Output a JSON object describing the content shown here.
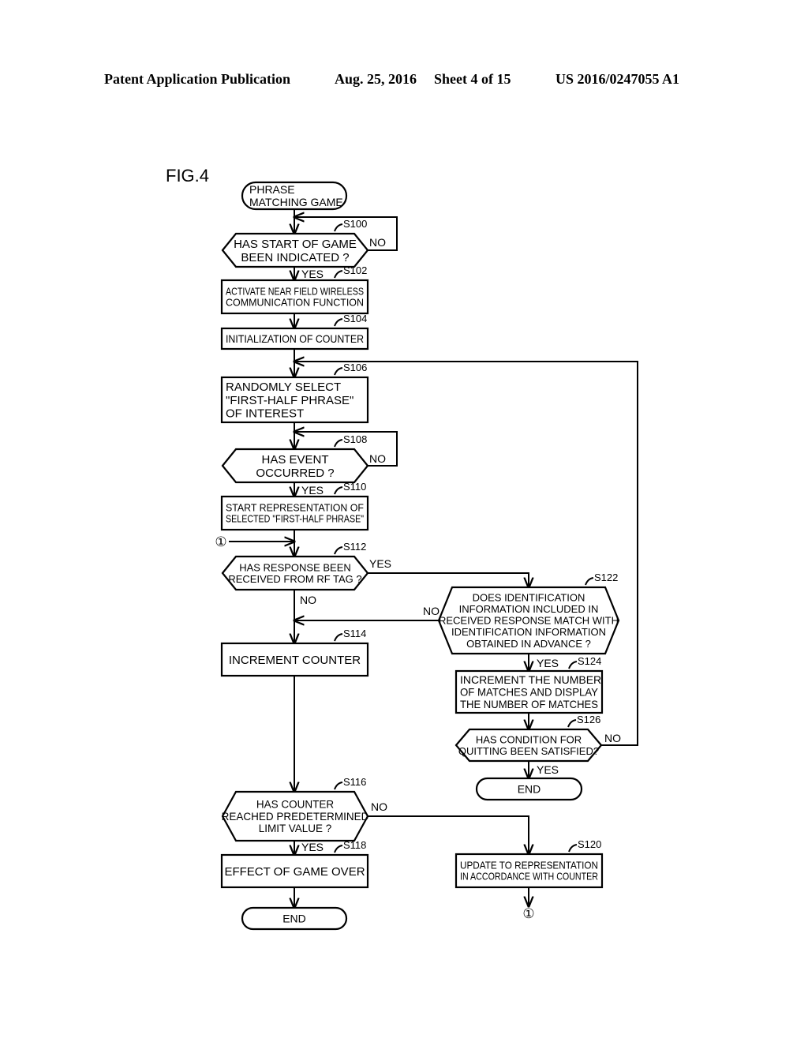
{
  "header": {
    "publication": "Patent Application Publication",
    "date": "Aug. 25, 2016",
    "sheet": "Sheet 4 of 15",
    "number": "US 2016/0247055 A1"
  },
  "figure": {
    "title": "FIG.4",
    "connector_symbol": "①",
    "nodes": [
      {
        "id": "start",
        "type": "terminal",
        "lines": [
          "PHRASE",
          "MATCHING GAME"
        ]
      },
      {
        "id": "S100",
        "type": "decision",
        "step": "S100",
        "lines": [
          "HAS START OF GAME",
          "BEEN INDICATED ?"
        ]
      },
      {
        "id": "S102",
        "type": "process",
        "step": "S102",
        "lines": [
          "ACTIVATE NEAR FIELD WIRELESS",
          "COMMUNICATION FUNCTION"
        ]
      },
      {
        "id": "S104",
        "type": "process",
        "step": "S104",
        "lines": [
          "INITIALIZATION OF COUNTER"
        ]
      },
      {
        "id": "S106",
        "type": "process",
        "step": "S106",
        "lines": [
          "RANDOMLY SELECT",
          "\"FIRST-HALF PHRASE\"",
          "OF INTEREST"
        ]
      },
      {
        "id": "S108",
        "type": "decision",
        "step": "S108",
        "lines": [
          "HAS EVENT",
          "OCCURRED ?"
        ]
      },
      {
        "id": "S110",
        "type": "process",
        "step": "S110",
        "lines": [
          "START REPRESENTATION OF",
          "SELECTED \"FIRST-HALF PHRASE\""
        ]
      },
      {
        "id": "S112",
        "type": "decision",
        "step": "S112",
        "lines": [
          "HAS RESPONSE BEEN",
          "RECEIVED FROM RF TAG ?"
        ]
      },
      {
        "id": "S114",
        "type": "process",
        "step": "S114",
        "lines": [
          "INCREMENT COUNTER"
        ]
      },
      {
        "id": "S116",
        "type": "decision",
        "step": "S116",
        "lines": [
          "HAS COUNTER",
          "REACHED PREDETERMINED",
          "LIMIT VALUE ?"
        ]
      },
      {
        "id": "S118",
        "type": "process",
        "step": "S118",
        "lines": [
          "EFFECT OF GAME OVER"
        ]
      },
      {
        "id": "end1",
        "type": "terminal",
        "lines": [
          "END"
        ]
      },
      {
        "id": "S120",
        "type": "process",
        "step": "S120",
        "lines": [
          "UPDATE TO REPRESENTATION",
          "IN ACCORDANCE WITH COUNTER"
        ]
      },
      {
        "id": "S122",
        "type": "decision",
        "step": "S122",
        "lines": [
          "DOES IDENTIFICATION",
          "INFORMATION INCLUDED IN",
          "RECEIVED RESPONSE MATCH WITH",
          "IDENTIFICATION INFORMATION",
          "OBTAINED IN ADVANCE ?"
        ]
      },
      {
        "id": "S124",
        "type": "process",
        "step": "S124",
        "lines": [
          "INCREMENT THE NUMBER",
          "OF MATCHES AND DISPLAY",
          "THE NUMBER OF MATCHES"
        ]
      },
      {
        "id": "S126",
        "type": "decision",
        "step": "S126",
        "lines": [
          "HAS CONDITION FOR",
          "QUITTING BEEN SATISFIED?"
        ]
      },
      {
        "id": "end2",
        "type": "terminal",
        "lines": [
          "END"
        ]
      }
    ],
    "edges": [
      {
        "from": "start",
        "to": "S100",
        "label": ""
      },
      {
        "from": "S100",
        "to": "S100",
        "label": "NO"
      },
      {
        "from": "S100",
        "to": "S102",
        "label": "YES"
      },
      {
        "from": "S102",
        "to": "S104",
        "label": ""
      },
      {
        "from": "S104",
        "to": "S106",
        "label": ""
      },
      {
        "from": "S106",
        "to": "S108",
        "label": ""
      },
      {
        "from": "S108",
        "to": "S108",
        "label": "NO"
      },
      {
        "from": "S108",
        "to": "S110",
        "label": "YES"
      },
      {
        "from": "S110",
        "to": "S112",
        "label": ""
      },
      {
        "from": "S112",
        "to": "S122",
        "label": "YES"
      },
      {
        "from": "S112",
        "to": "S114",
        "label": "NO"
      },
      {
        "from": "S122",
        "to": "S114",
        "label": "NO"
      },
      {
        "from": "S122",
        "to": "S124",
        "label": "YES"
      },
      {
        "from": "S124",
        "to": "S126",
        "label": ""
      },
      {
        "from": "S126",
        "to": "S106",
        "label": "NO"
      },
      {
        "from": "S126",
        "to": "end2",
        "label": "YES"
      },
      {
        "from": "S114",
        "to": "S116",
        "label": ""
      },
      {
        "from": "S116",
        "to": "S118",
        "label": "YES"
      },
      {
        "from": "S116",
        "to": "S120",
        "label": "NO"
      },
      {
        "from": "S118",
        "to": "end1",
        "label": ""
      },
      {
        "from": "S120",
        "to": "connector-1",
        "label": ""
      },
      {
        "from": "connector-1",
        "to": "S112",
        "label": ""
      }
    ]
  }
}
